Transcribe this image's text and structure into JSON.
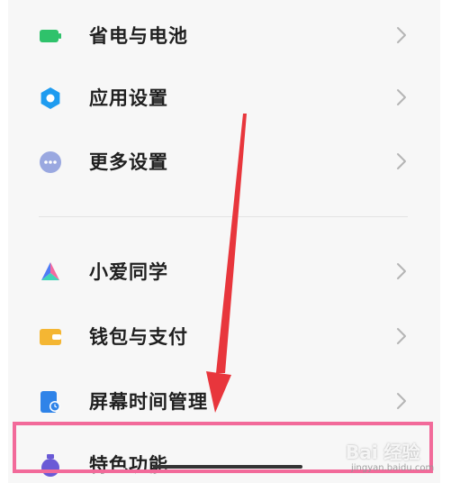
{
  "settings": {
    "items": [
      {
        "label": "省电与电池",
        "icon": "battery-icon",
        "color": "#2fc26b"
      },
      {
        "label": "应用设置",
        "icon": "gear-icon",
        "color": "#1f9cf0"
      },
      {
        "label": "更多设置",
        "icon": "more-dots-icon",
        "color": "#9aa8e0"
      },
      {
        "label": "小爱同学",
        "icon": "xiaoai-icon",
        "color": "#4f7cf5"
      },
      {
        "label": "钱包与支付",
        "icon": "wallet-icon",
        "color": "#f4b633"
      },
      {
        "label": "屏幕时间管理",
        "icon": "screen-time-icon",
        "color": "#2f83e8"
      },
      {
        "label": "特色功能",
        "icon": "special-feature-icon",
        "color": "#6a5ad6"
      }
    ]
  },
  "annotation": {
    "arrow_color": "#e8363c",
    "highlight_color": "#f26a9a"
  },
  "watermark": {
    "text": "Bai 经验",
    "sub": "jingyan.baidu.com"
  }
}
